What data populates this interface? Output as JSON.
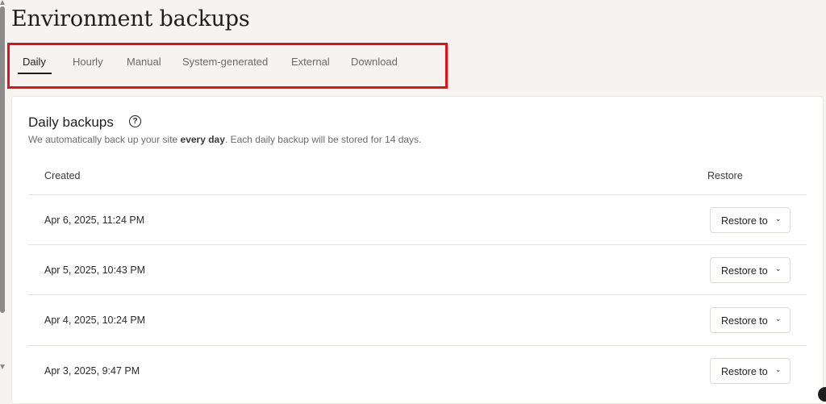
{
  "page": {
    "title": "Environment backups"
  },
  "tabs": [
    {
      "label": "Daily",
      "active": true
    },
    {
      "label": "Hourly"
    },
    {
      "label": "Manual"
    },
    {
      "label": "System-generated"
    },
    {
      "label": "External"
    },
    {
      "label": "Download"
    }
  ],
  "section": {
    "title": "Daily backups",
    "help_icon": "question-circle-icon",
    "description_prefix": "We automatically back up your site ",
    "description_bold": "every day",
    "description_suffix": ". Each daily backup will be stored for 14 days."
  },
  "table": {
    "columns": [
      "Created",
      "Restore"
    ],
    "rows": [
      {
        "created": "Apr 6, 2025, 11:24 PM",
        "action": "Restore to"
      },
      {
        "created": "Apr 5, 2025, 10:43 PM",
        "action": "Restore to"
      },
      {
        "created": "Apr 4, 2025, 10:24 PM",
        "action": "Restore to"
      },
      {
        "created": "Apr 3, 2025, 9:47 PM",
        "action": "Restore to"
      }
    ]
  },
  "colors": {
    "highlight_border": "#e3121a",
    "background": "#f6f3f0"
  }
}
